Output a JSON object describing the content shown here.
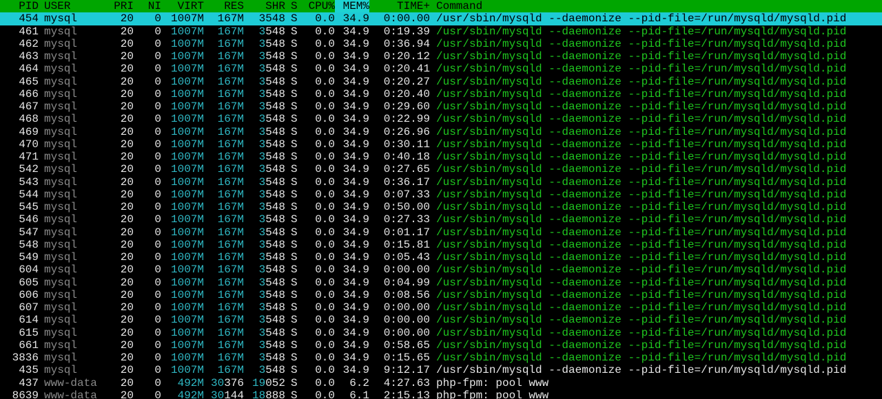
{
  "header": {
    "pid": "PID",
    "user": "USER",
    "pri": "PRI",
    "ni": "NI",
    "virt": "VIRT",
    "res": "RES",
    "shr": "SHR",
    "s": "S",
    "cpu": "CPU%",
    "mem": "MEM%",
    "time": "TIME+",
    "command": "Command"
  },
  "sort_column": "MEM%",
  "colors": {
    "header_bg": "#00a600",
    "selected_bg": "#1ecbd6",
    "thread_command": "#1fc71f",
    "memory_value": "#2fb8c4",
    "user_dim": "#8a8a8a"
  },
  "processes": [
    {
      "pid": "454",
      "user": "mysql",
      "pri": "20",
      "ni": "0",
      "virt": "1007M",
      "res": "167M",
      "shr_a": "3",
      "shr_b": "548",
      "s": "S",
      "cpu": "0.0",
      "mem": "34.9",
      "time": "0:00.00",
      "command": "/usr/sbin/mysqld --daemonize --pid-file=/run/mysqld/mysqld.pid",
      "selected": true,
      "thread": false
    },
    {
      "pid": "461",
      "user": "mysql",
      "pri": "20",
      "ni": "0",
      "virt": "1007M",
      "res": "167M",
      "shr_a": "3",
      "shr_b": "548",
      "s": "S",
      "cpu": "0.0",
      "mem": "34.9",
      "time": "0:19.39",
      "command": "/usr/sbin/mysqld --daemonize --pid-file=/run/mysqld/mysqld.pid",
      "thread": true
    },
    {
      "pid": "462",
      "user": "mysql",
      "pri": "20",
      "ni": "0",
      "virt": "1007M",
      "res": "167M",
      "shr_a": "3",
      "shr_b": "548",
      "s": "S",
      "cpu": "0.0",
      "mem": "34.9",
      "time": "0:36.94",
      "command": "/usr/sbin/mysqld --daemonize --pid-file=/run/mysqld/mysqld.pid",
      "thread": true
    },
    {
      "pid": "463",
      "user": "mysql",
      "pri": "20",
      "ni": "0",
      "virt": "1007M",
      "res": "167M",
      "shr_a": "3",
      "shr_b": "548",
      "s": "S",
      "cpu": "0.0",
      "mem": "34.9",
      "time": "0:20.12",
      "command": "/usr/sbin/mysqld --daemonize --pid-file=/run/mysqld/mysqld.pid",
      "thread": true
    },
    {
      "pid": "464",
      "user": "mysql",
      "pri": "20",
      "ni": "0",
      "virt": "1007M",
      "res": "167M",
      "shr_a": "3",
      "shr_b": "548",
      "s": "S",
      "cpu": "0.0",
      "mem": "34.9",
      "time": "0:20.41",
      "command": "/usr/sbin/mysqld --daemonize --pid-file=/run/mysqld/mysqld.pid",
      "thread": true
    },
    {
      "pid": "465",
      "user": "mysql",
      "pri": "20",
      "ni": "0",
      "virt": "1007M",
      "res": "167M",
      "shr_a": "3",
      "shr_b": "548",
      "s": "S",
      "cpu": "0.0",
      "mem": "34.9",
      "time": "0:20.27",
      "command": "/usr/sbin/mysqld --daemonize --pid-file=/run/mysqld/mysqld.pid",
      "thread": true
    },
    {
      "pid": "466",
      "user": "mysql",
      "pri": "20",
      "ni": "0",
      "virt": "1007M",
      "res": "167M",
      "shr_a": "3",
      "shr_b": "548",
      "s": "S",
      "cpu": "0.0",
      "mem": "34.9",
      "time": "0:20.40",
      "command": "/usr/sbin/mysqld --daemonize --pid-file=/run/mysqld/mysqld.pid",
      "thread": true
    },
    {
      "pid": "467",
      "user": "mysql",
      "pri": "20",
      "ni": "0",
      "virt": "1007M",
      "res": "167M",
      "shr_a": "3",
      "shr_b": "548",
      "s": "S",
      "cpu": "0.0",
      "mem": "34.9",
      "time": "0:29.60",
      "command": "/usr/sbin/mysqld --daemonize --pid-file=/run/mysqld/mysqld.pid",
      "thread": true
    },
    {
      "pid": "468",
      "user": "mysql",
      "pri": "20",
      "ni": "0",
      "virt": "1007M",
      "res": "167M",
      "shr_a": "3",
      "shr_b": "548",
      "s": "S",
      "cpu": "0.0",
      "mem": "34.9",
      "time": "0:22.99",
      "command": "/usr/sbin/mysqld --daemonize --pid-file=/run/mysqld/mysqld.pid",
      "thread": true
    },
    {
      "pid": "469",
      "user": "mysql",
      "pri": "20",
      "ni": "0",
      "virt": "1007M",
      "res": "167M",
      "shr_a": "3",
      "shr_b": "548",
      "s": "S",
      "cpu": "0.0",
      "mem": "34.9",
      "time": "0:26.96",
      "command": "/usr/sbin/mysqld --daemonize --pid-file=/run/mysqld/mysqld.pid",
      "thread": true
    },
    {
      "pid": "470",
      "user": "mysql",
      "pri": "20",
      "ni": "0",
      "virt": "1007M",
      "res": "167M",
      "shr_a": "3",
      "shr_b": "548",
      "s": "S",
      "cpu": "0.0",
      "mem": "34.9",
      "time": "0:30.11",
      "command": "/usr/sbin/mysqld --daemonize --pid-file=/run/mysqld/mysqld.pid",
      "thread": true
    },
    {
      "pid": "471",
      "user": "mysql",
      "pri": "20",
      "ni": "0",
      "virt": "1007M",
      "res": "167M",
      "shr_a": "3",
      "shr_b": "548",
      "s": "S",
      "cpu": "0.0",
      "mem": "34.9",
      "time": "0:40.18",
      "command": "/usr/sbin/mysqld --daemonize --pid-file=/run/mysqld/mysqld.pid",
      "thread": true
    },
    {
      "pid": "542",
      "user": "mysql",
      "pri": "20",
      "ni": "0",
      "virt": "1007M",
      "res": "167M",
      "shr_a": "3",
      "shr_b": "548",
      "s": "S",
      "cpu": "0.0",
      "mem": "34.9",
      "time": "0:27.65",
      "command": "/usr/sbin/mysqld --daemonize --pid-file=/run/mysqld/mysqld.pid",
      "thread": true
    },
    {
      "pid": "543",
      "user": "mysql",
      "pri": "20",
      "ni": "0",
      "virt": "1007M",
      "res": "167M",
      "shr_a": "3",
      "shr_b": "548",
      "s": "S",
      "cpu": "0.0",
      "mem": "34.9",
      "time": "0:36.17",
      "command": "/usr/sbin/mysqld --daemonize --pid-file=/run/mysqld/mysqld.pid",
      "thread": true
    },
    {
      "pid": "544",
      "user": "mysql",
      "pri": "20",
      "ni": "0",
      "virt": "1007M",
      "res": "167M",
      "shr_a": "3",
      "shr_b": "548",
      "s": "S",
      "cpu": "0.0",
      "mem": "34.9",
      "time": "0:07.33",
      "command": "/usr/sbin/mysqld --daemonize --pid-file=/run/mysqld/mysqld.pid",
      "thread": true
    },
    {
      "pid": "545",
      "user": "mysql",
      "pri": "20",
      "ni": "0",
      "virt": "1007M",
      "res": "167M",
      "shr_a": "3",
      "shr_b": "548",
      "s": "S",
      "cpu": "0.0",
      "mem": "34.9",
      "time": "0:50.00",
      "command": "/usr/sbin/mysqld --daemonize --pid-file=/run/mysqld/mysqld.pid",
      "thread": true
    },
    {
      "pid": "546",
      "user": "mysql",
      "pri": "20",
      "ni": "0",
      "virt": "1007M",
      "res": "167M",
      "shr_a": "3",
      "shr_b": "548",
      "s": "S",
      "cpu": "0.0",
      "mem": "34.9",
      "time": "0:27.33",
      "command": "/usr/sbin/mysqld --daemonize --pid-file=/run/mysqld/mysqld.pid",
      "thread": true
    },
    {
      "pid": "547",
      "user": "mysql",
      "pri": "20",
      "ni": "0",
      "virt": "1007M",
      "res": "167M",
      "shr_a": "3",
      "shr_b": "548",
      "s": "S",
      "cpu": "0.0",
      "mem": "34.9",
      "time": "0:01.17",
      "command": "/usr/sbin/mysqld --daemonize --pid-file=/run/mysqld/mysqld.pid",
      "thread": true
    },
    {
      "pid": "548",
      "user": "mysql",
      "pri": "20",
      "ni": "0",
      "virt": "1007M",
      "res": "167M",
      "shr_a": "3",
      "shr_b": "548",
      "s": "S",
      "cpu": "0.0",
      "mem": "34.9",
      "time": "0:15.81",
      "command": "/usr/sbin/mysqld --daemonize --pid-file=/run/mysqld/mysqld.pid",
      "thread": true
    },
    {
      "pid": "549",
      "user": "mysql",
      "pri": "20",
      "ni": "0",
      "virt": "1007M",
      "res": "167M",
      "shr_a": "3",
      "shr_b": "548",
      "s": "S",
      "cpu": "0.0",
      "mem": "34.9",
      "time": "0:05.43",
      "command": "/usr/sbin/mysqld --daemonize --pid-file=/run/mysqld/mysqld.pid",
      "thread": true
    },
    {
      "pid": "604",
      "user": "mysql",
      "pri": "20",
      "ni": "0",
      "virt": "1007M",
      "res": "167M",
      "shr_a": "3",
      "shr_b": "548",
      "s": "S",
      "cpu": "0.0",
      "mem": "34.9",
      "time": "0:00.00",
      "command": "/usr/sbin/mysqld --daemonize --pid-file=/run/mysqld/mysqld.pid",
      "thread": true
    },
    {
      "pid": "605",
      "user": "mysql",
      "pri": "20",
      "ni": "0",
      "virt": "1007M",
      "res": "167M",
      "shr_a": "3",
      "shr_b": "548",
      "s": "S",
      "cpu": "0.0",
      "mem": "34.9",
      "time": "0:04.99",
      "command": "/usr/sbin/mysqld --daemonize --pid-file=/run/mysqld/mysqld.pid",
      "thread": true
    },
    {
      "pid": "606",
      "user": "mysql",
      "pri": "20",
      "ni": "0",
      "virt": "1007M",
      "res": "167M",
      "shr_a": "3",
      "shr_b": "548",
      "s": "S",
      "cpu": "0.0",
      "mem": "34.9",
      "time": "0:08.56",
      "command": "/usr/sbin/mysqld --daemonize --pid-file=/run/mysqld/mysqld.pid",
      "thread": true
    },
    {
      "pid": "607",
      "user": "mysql",
      "pri": "20",
      "ni": "0",
      "virt": "1007M",
      "res": "167M",
      "shr_a": "3",
      "shr_b": "548",
      "s": "S",
      "cpu": "0.0",
      "mem": "34.9",
      "time": "0:00.00",
      "command": "/usr/sbin/mysqld --daemonize --pid-file=/run/mysqld/mysqld.pid",
      "thread": true
    },
    {
      "pid": "614",
      "user": "mysql",
      "pri": "20",
      "ni": "0",
      "virt": "1007M",
      "res": "167M",
      "shr_a": "3",
      "shr_b": "548",
      "s": "S",
      "cpu": "0.0",
      "mem": "34.9",
      "time": "0:00.00",
      "command": "/usr/sbin/mysqld --daemonize --pid-file=/run/mysqld/mysqld.pid",
      "thread": true
    },
    {
      "pid": "615",
      "user": "mysql",
      "pri": "20",
      "ni": "0",
      "virt": "1007M",
      "res": "167M",
      "shr_a": "3",
      "shr_b": "548",
      "s": "S",
      "cpu": "0.0",
      "mem": "34.9",
      "time": "0:00.00",
      "command": "/usr/sbin/mysqld --daemonize --pid-file=/run/mysqld/mysqld.pid",
      "thread": true
    },
    {
      "pid": "661",
      "user": "mysql",
      "pri": "20",
      "ni": "0",
      "virt": "1007M",
      "res": "167M",
      "shr_a": "3",
      "shr_b": "548",
      "s": "S",
      "cpu": "0.0",
      "mem": "34.9",
      "time": "0:58.65",
      "command": "/usr/sbin/mysqld --daemonize --pid-file=/run/mysqld/mysqld.pid",
      "thread": true
    },
    {
      "pid": "3836",
      "user": "mysql",
      "pri": "20",
      "ni": "0",
      "virt": "1007M",
      "res": "167M",
      "shr_a": "3",
      "shr_b": "548",
      "s": "S",
      "cpu": "0.0",
      "mem": "34.9",
      "time": "0:15.65",
      "command": "/usr/sbin/mysqld --daemonize --pid-file=/run/mysqld/mysqld.pid",
      "thread": true
    },
    {
      "pid": "435",
      "user": "mysql",
      "pri": "20",
      "ni": "0",
      "virt": "1007M",
      "res": "167M",
      "shr_a": "3",
      "shr_b": "548",
      "s": "S",
      "cpu": "0.0",
      "mem": "34.9",
      "time": "9:12.17",
      "command": "/usr/sbin/mysqld --daemonize --pid-file=/run/mysqld/mysqld.pid",
      "thread": false
    },
    {
      "pid": "437",
      "user": "www-data",
      "pri": "20",
      "ni": "0",
      "virt": "492M",
      "res_a": "30",
      "res_b": "376",
      "shr_a": "19",
      "shr_b": "052",
      "s": "S",
      "cpu": "0.0",
      "mem": "6.2",
      "time": "4:27.63",
      "command": "php-fpm: pool www",
      "thread": false,
      "plain_res": true
    },
    {
      "pid": "8639",
      "user": "www-data",
      "pri": "20",
      "ni": "0",
      "virt": "492M",
      "res_a": "30",
      "res_b": "144",
      "shr_a": "18",
      "shr_b": "888",
      "s": "S",
      "cpu": "0.0",
      "mem": "6.1",
      "time": "2:15.13",
      "command": "php-fpm: pool www",
      "thread": false,
      "plain_res": true
    }
  ]
}
